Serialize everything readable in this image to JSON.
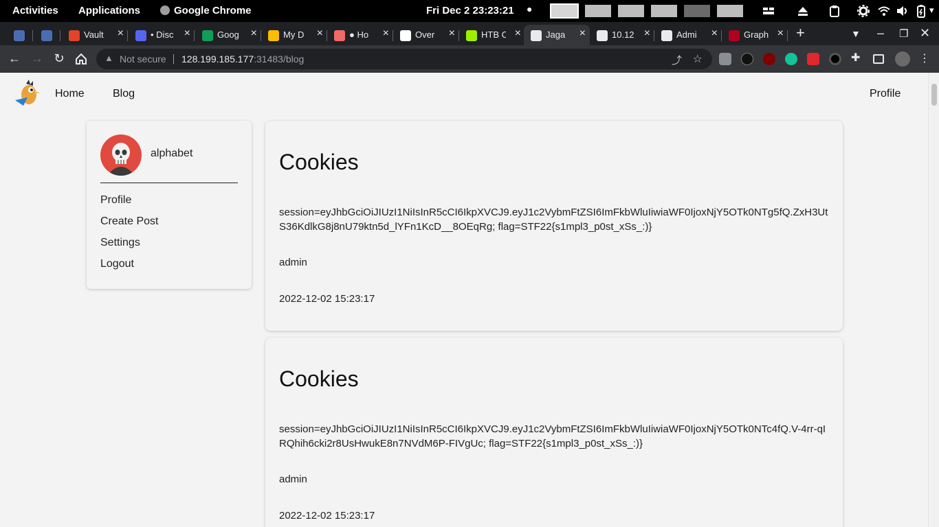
{
  "gnome": {
    "activities": "Activities",
    "applications": "Applications",
    "app_name": "Google Chrome",
    "clock": "Fri Dec 2  23:23:21"
  },
  "browser": {
    "tabs": [
      {
        "title": "",
        "favicon_color": "#4a6cb3"
      },
      {
        "title": "",
        "favicon_color": "#4a6cb3"
      },
      {
        "title": "Vault",
        "favicon_color": "#e24329"
      },
      {
        "title": "• Disc",
        "favicon_color": "#5865f2"
      },
      {
        "title": "Goog",
        "favicon_color": "#0f9d58"
      },
      {
        "title": "My D",
        "favicon_color": "#fbbc04"
      },
      {
        "title": "● Ho",
        "favicon_color": "#f06a6a"
      },
      {
        "title": "Over",
        "favicon_color": "#ffffff"
      },
      {
        "title": "HTB C",
        "favicon_color": "#9fef00"
      },
      {
        "title": "Jaga",
        "favicon_color": "#e8eaed"
      },
      {
        "title": "10.12",
        "favicon_color": "#e8eaed"
      },
      {
        "title": "Admi",
        "favicon_color": "#e8eaed"
      },
      {
        "title": "Graph",
        "favicon_color": "#b00020"
      }
    ],
    "new_tab": "+",
    "security_label": "Not secure",
    "url_host": "128.199.185.177",
    "url_rest": ":31483/blog"
  },
  "site": {
    "nav": {
      "home": "Home",
      "blog": "Blog",
      "profile": "Profile"
    },
    "sidebar": {
      "username": "alphabet",
      "menu": [
        "Profile",
        "Create Post",
        "Settings",
        "Logout"
      ]
    },
    "posts": [
      {
        "title": "Cookies",
        "body": "session=eyJhbGciOiJIUzI1NiIsInR5cCI6IkpXVCJ9.eyJ1c2VybmFtZSI6ImFkbWluIiwiaWF0IjoxNjY5OTk0NTg5fQ.ZxH3UtS36KdlkG8j8nU79ktn5d_lYFn1KcD__8OEqRg; flag=STF22{s1mpl3_p0st_xSs_:)}",
        "author": "admin",
        "date": "2022-12-02 15:23:17"
      },
      {
        "title": "Cookies",
        "body": "session=eyJhbGciOiJIUzI1NiIsInR5cCI6IkpXVCJ9.eyJ1c2VybmFtZSI6ImFkbWluIiwiaWF0IjoxNjY5OTk0NTc4fQ.V-4rr-qIRQhih6cki2r8UsHwukE8n7NVdM6P-FIVgUc; flag=STF22{s1mpl3_p0st_xSs_:)}",
        "author": "admin",
        "date": "2022-12-02 15:23:17"
      }
    ]
  }
}
